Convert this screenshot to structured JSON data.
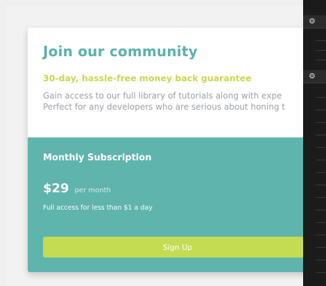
{
  "card": {
    "title": "Join our community",
    "guarantee": "30-day, hassle-free money back guarantee",
    "description_line1": "Gain access to our full library of tutorials along with expe",
    "description_line2": "Perfect for any developers who are serious about honing t"
  },
  "subscription": {
    "plan_name": "Monthly Subscription",
    "price": "$29",
    "per": "per month",
    "tagline": "Full access for less than $1 a day",
    "signup_label": "Sign Up"
  },
  "right_panel": {
    "icons": [
      "gear-icon",
      "gear-icon"
    ]
  },
  "colors": {
    "title": "#59b2ab",
    "guarantee": "#c7d84c",
    "subscription_bg": "#5fb4ad",
    "signup_button": "#c4dc52"
  }
}
